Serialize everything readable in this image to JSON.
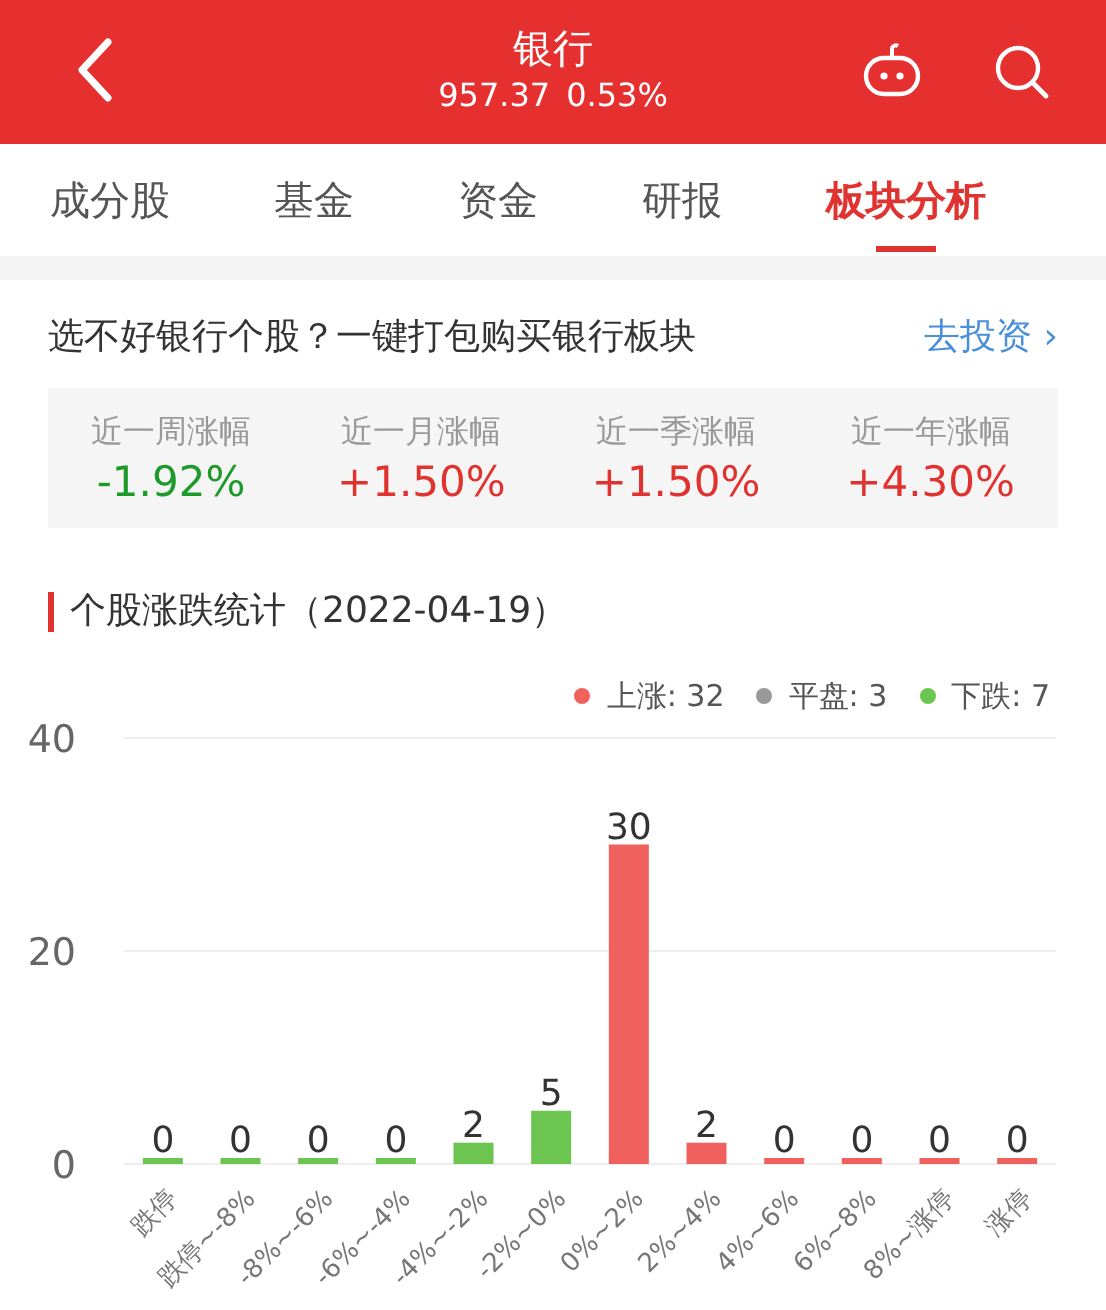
{
  "header": {
    "title": "银行",
    "price": "957.37",
    "change": "0.53%"
  },
  "tabs": [
    {
      "label": "成分股",
      "selected": false
    },
    {
      "label": "基金",
      "selected": false
    },
    {
      "label": "资金",
      "selected": false
    },
    {
      "label": "研报",
      "selected": false
    },
    {
      "label": "板块分析",
      "selected": true
    }
  ],
  "promo": {
    "text": "选不好银行个股？一键打包购买银行板块",
    "link": "去投资",
    "chevron": "›"
  },
  "stats": [
    {
      "label": "近一周涨幅",
      "value": "-1.92%",
      "color": "#1d9a2a"
    },
    {
      "label": "近一月涨幅",
      "value": "+1.50%",
      "color": "#e0322f"
    },
    {
      "label": "近一季涨幅",
      "value": "+1.50%",
      "color": "#e0322f"
    },
    {
      "label": "近一年涨幅",
      "value": "+4.30%",
      "color": "#e0322f"
    }
  ],
  "section": {
    "title": "个股涨跌统计（2022-04-19）"
  },
  "legend": [
    {
      "label": "上涨: 32",
      "color": "#f0605d"
    },
    {
      "label": "平盘: 3",
      "color": "#999999"
    },
    {
      "label": "下跌: 7",
      "color": "#6cc551"
    }
  ],
  "chart_data": {
    "type": "bar",
    "categories": [
      "跌停",
      "跌停~-8%",
      "-8%~-6%",
      "-6%~-4%",
      "-4%~-2%",
      "-2%~0%",
      "0%~2%",
      "2%~4%",
      "4%~6%",
      "6%~8%",
      "8%~涨停",
      "涨停"
    ],
    "series": [
      {
        "color": "#6cc551",
        "values": [
          0,
          0,
          0,
          0,
          2,
          5,
          null,
          null,
          null,
          null,
          null,
          null
        ]
      },
      {
        "color": "#f0605d",
        "values": [
          null,
          null,
          null,
          null,
          null,
          null,
          30,
          2,
          0,
          0,
          0,
          0
        ]
      }
    ],
    "stacked": true,
    "ylim": [
      0,
      40
    ],
    "yticks": [
      0,
      20,
      40
    ],
    "data_labels": true
  }
}
